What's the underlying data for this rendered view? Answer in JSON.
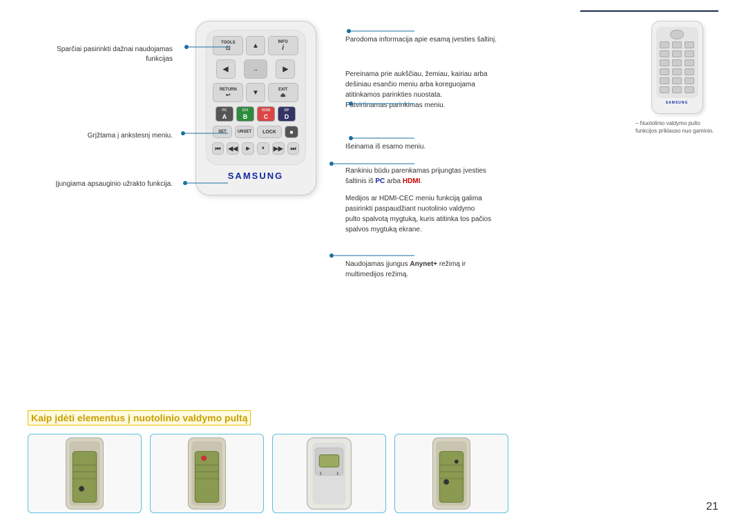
{
  "page": {
    "number": "21"
  },
  "divider": {
    "visible": true
  },
  "remote": {
    "tools_label": "TOOLS",
    "info_label": "INFO",
    "return_label": "RETURN",
    "exit_label": "EXIT",
    "samsung_logo": "SAMSUNG",
    "color_buttons": [
      {
        "label": "PC",
        "letter": "A",
        "class": "btn-pc"
      },
      {
        "label": "DVI",
        "letter": "B",
        "class": "btn-dvi"
      },
      {
        "label": "HDMI",
        "letter": "C",
        "class": "btn-hdmi"
      },
      {
        "label": "DP",
        "letter": "D",
        "class": "btn-dp"
      }
    ],
    "lock_label": "LOCK",
    "set_label": "SET",
    "unset_label": "UNSET"
  },
  "left_annotations": [
    {
      "id": "ann1",
      "text": "Sparčiai pasirinkti dažnai naudojamas funkcijas"
    },
    {
      "id": "ann2",
      "text": "Grįžtama į ankstesnį meniu."
    },
    {
      "id": "ann3",
      "text": "Įjungiama apsauginio užrakto funkcija."
    }
  ],
  "right_annotations": [
    {
      "id": "rann1",
      "text": "Parodoma informacija apie esamą įvesties šaltinį."
    },
    {
      "id": "rann2",
      "text": "Pereinama prie aukščiau, žemiau, kairiau arba\ndešiniau esančio meniu arba koreguojama\natitinkamos parinkties nuostata.\nPatvirtinamas parinkimas meniu."
    },
    {
      "id": "rann3",
      "text": "Išeinama iš esamo meniu."
    },
    {
      "id": "rann4",
      "text": "Rankiniu būdu parenkamas prijungtas įvesties\nšaltinis iš PC arba HDMI.",
      "has_bold": true,
      "pc_bold": "PC",
      "hdmi_bold": "HDMI"
    },
    {
      "id": "rann5",
      "text": "Medijos ar HDMI-CEC meniu funkciją galima\npasirinkti paspaudžiant nuotolinio valdymo\npulto spalvotą mygtuką, kuris atitinka tos pačios\nspalvos mygtuką ekrane."
    },
    {
      "id": "rann6",
      "text": "Naudojamas įjungus Anynet+ režimą ir\nmultimedijos režimą.",
      "anynet_bold": "Anynet+"
    }
  ],
  "small_remote_note": {
    "dash": "–",
    "text": "Nuotolinio valdymo pulto funkcijos\npriklauso nuo gaminio."
  },
  "bottom": {
    "title": "Kaip įdėti elementus į nuotolinio valdymo pultą",
    "images_count": 4
  }
}
